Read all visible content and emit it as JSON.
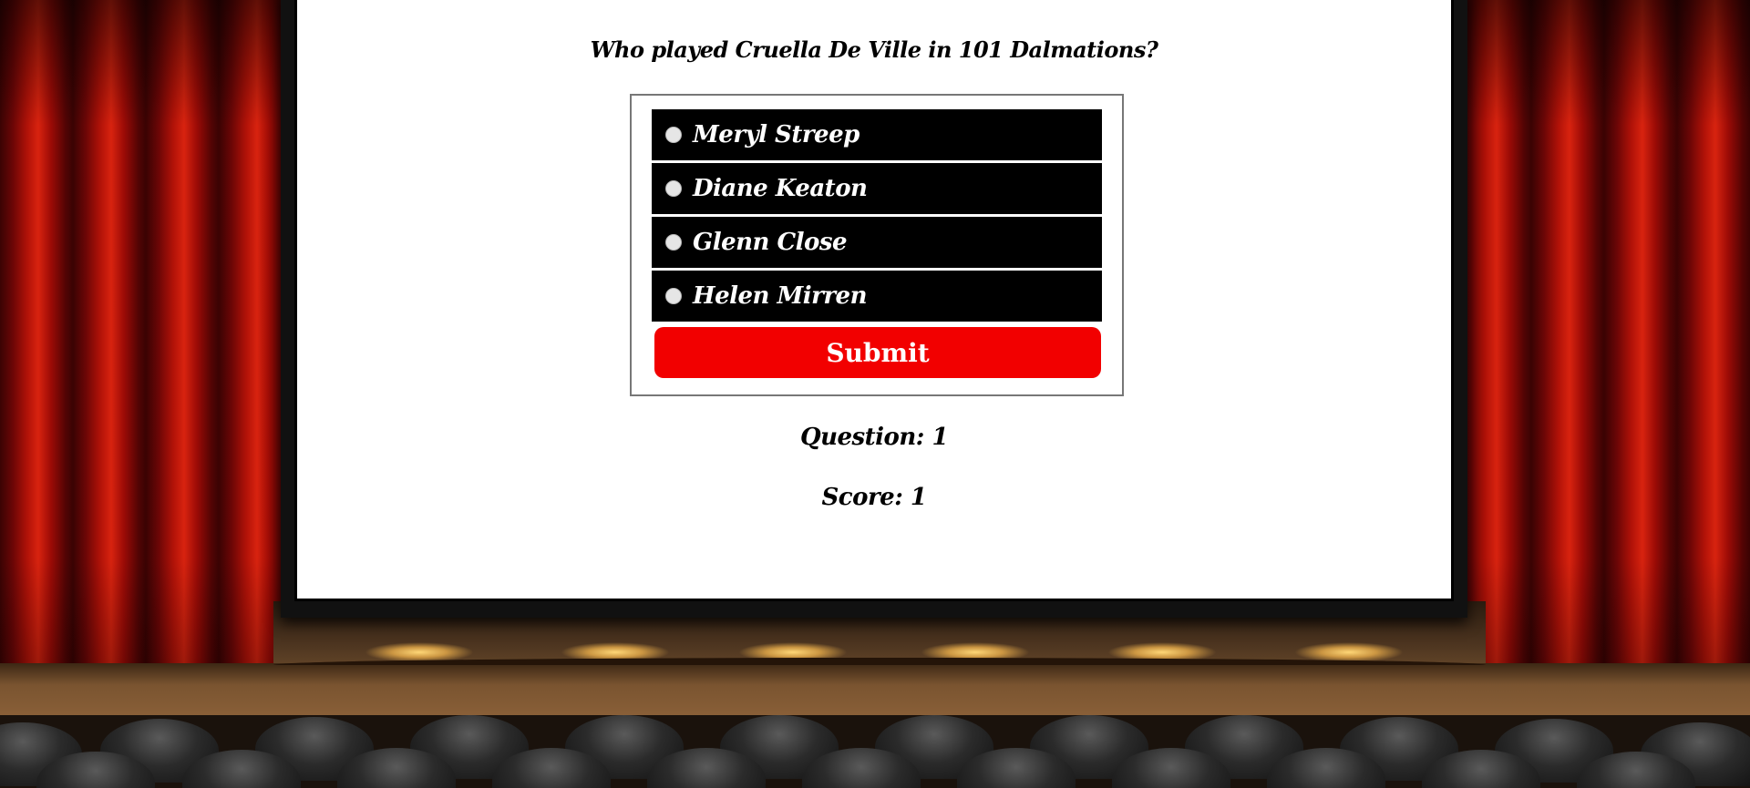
{
  "quiz": {
    "question": "Who played Cruella De Ville in 101 Dalmations?",
    "options": [
      {
        "label": "Meryl Streep"
      },
      {
        "label": "Diane Keaton"
      },
      {
        "label": "Glenn Close"
      },
      {
        "label": "Helen Mirren"
      }
    ],
    "submit_label": "Submit",
    "question_counter": "Question: 1",
    "score": "Score: 1"
  },
  "colors": {
    "submit_button": "#f20000",
    "option_background": "#000000",
    "screen_background": "#ffffff"
  }
}
